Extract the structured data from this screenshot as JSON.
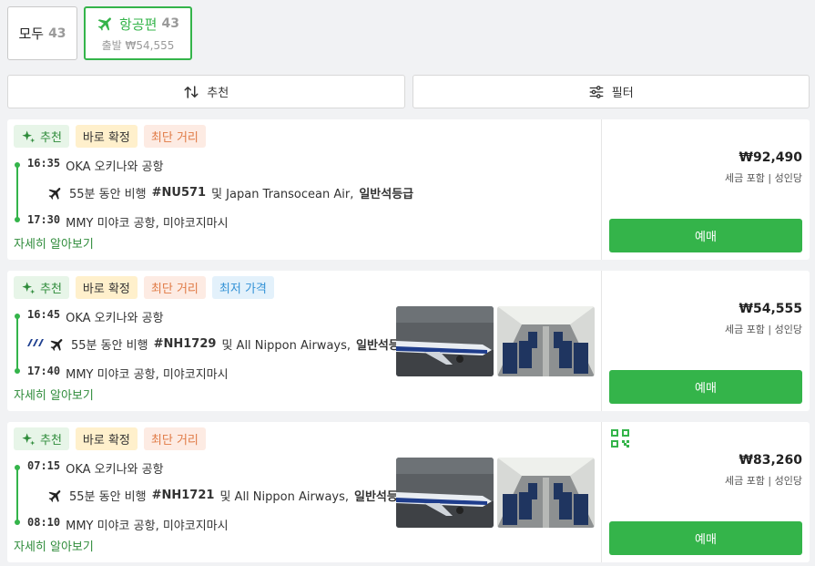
{
  "tabs": {
    "all": {
      "label": "모두",
      "count": "43"
    },
    "flight": {
      "label": "항공편",
      "count": "43",
      "sub": "출발 ₩54,555"
    }
  },
  "toolbar": {
    "sort_label": "추천",
    "filter_label": "필터"
  },
  "colors": {
    "accent": "#34b44a"
  },
  "results": [
    {
      "badges": [
        "추천",
        "바로 확정",
        "최단 거리"
      ],
      "dep_time": "16:35",
      "dep_place": "OKA 오키나와 공항",
      "flight_text_pre": "55분 동안 비행",
      "flight_no": "#NU571",
      "flight_text_mid": "및 Japan Transocean Air,",
      "cabin": "일반석등급",
      "arr_time": "17:30",
      "arr_place": "MMY 미야코 공항, 미야코지마시",
      "details": "자세히 알아보기",
      "price": "₩92,490",
      "price_note": "세금 포함 | 성인당",
      "book": "예매"
    },
    {
      "badges": [
        "추천",
        "바로 확정",
        "최단 거리",
        "최저 가격"
      ],
      "dep_time": "16:45",
      "dep_place": "OKA 오키나와 공항",
      "flight_text_pre": "55분 동안 비행",
      "flight_no": "#NH1729",
      "flight_text_mid": "및 All Nippon Airways,",
      "cabin": "일반석등급",
      "arr_time": "17:40",
      "arr_place": "MMY 미야코 공항, 미야코지마시",
      "details": "자세히 알아보기",
      "price": "₩54,555",
      "price_note": "세금 포함 | 성인당",
      "book": "예매"
    },
    {
      "badges": [
        "추천",
        "바로 확정",
        "최단 거리"
      ],
      "dep_time": "07:15",
      "dep_place": "OKA 오키나와 공항",
      "flight_text_pre": "55분 동안 비행",
      "flight_no": "#NH1721",
      "flight_text_mid": "및 All Nippon Airways,",
      "cabin": "일반석등급",
      "arr_time": "08:10",
      "arr_place": "MMY 미야코 공항, 미야코지마시",
      "details": "자세히 알아보기",
      "price": "₩83,260",
      "price_note": "세금 포함 | 성인당",
      "book": "예매"
    }
  ]
}
